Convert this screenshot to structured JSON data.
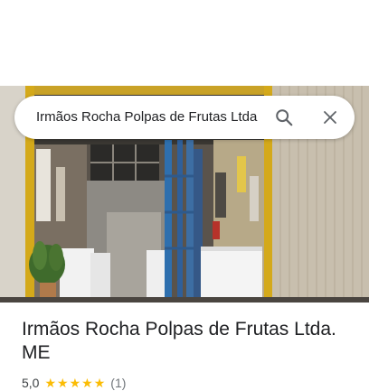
{
  "search": {
    "query": "Irmãos Rocha Polpas de Frutas Ltda"
  },
  "place": {
    "title": "Irmãos Rocha Polpas de Frutas Ltda. ME",
    "rating": "5,0",
    "review_count": "(1)"
  },
  "icons": {
    "search": "search-icon",
    "close": "close-icon",
    "star": "star-icon"
  },
  "colors": {
    "star": "#fbbc04",
    "text": "#202124",
    "secondary": "#70757a"
  }
}
